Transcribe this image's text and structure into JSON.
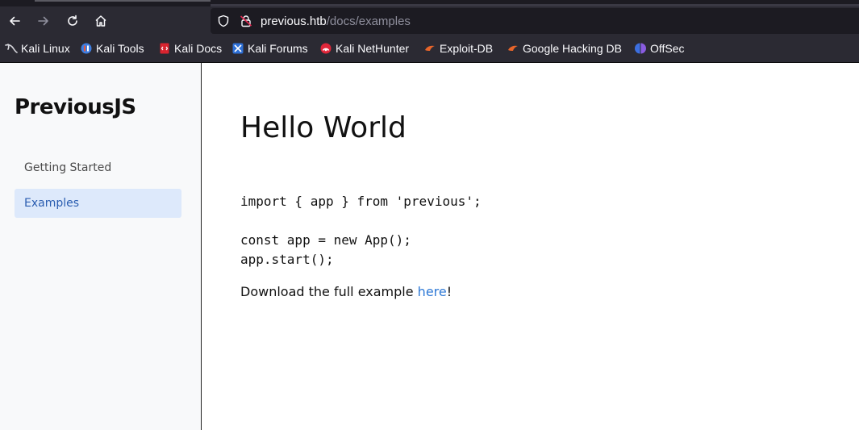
{
  "browser": {
    "url_host": "previous.htb",
    "url_path": "/docs/examples",
    "bookmarks": [
      {
        "label": "Kali Linux",
        "icon": "kali-dragon-icon"
      },
      {
        "label": "Kali Tools",
        "icon": "kali-tools-icon"
      },
      {
        "label": "Kali Docs",
        "icon": "kali-docs-icon"
      },
      {
        "label": "Kali Forums",
        "icon": "kali-forums-icon"
      },
      {
        "label": "Kali NetHunter",
        "icon": "nethunter-icon"
      },
      {
        "label": "Exploit-DB",
        "icon": "exploit-db-icon"
      },
      {
        "label": "Google Hacking DB",
        "icon": "ghdb-icon"
      },
      {
        "label": "OffSec",
        "icon": "offsec-icon"
      }
    ]
  },
  "sidebar": {
    "brand": "PreviousJS",
    "items": [
      {
        "label": "Getting Started",
        "active": false
      },
      {
        "label": "Examples",
        "active": true
      }
    ]
  },
  "main": {
    "title": "Hello World",
    "code": "import { app } from 'previous';\n\nconst app = new App();\napp.start();",
    "download_prefix": "Download the full example ",
    "download_link": "here",
    "download_suffix": "!"
  },
  "colors": {
    "chrome_bg": "#2b2a33",
    "url_bg": "#1c1b22",
    "sidebar_bg": "#f8f9fa",
    "active_item_bg": "#dde9fb",
    "active_item_text": "#2a5db0",
    "link": "#2f7ad6"
  }
}
